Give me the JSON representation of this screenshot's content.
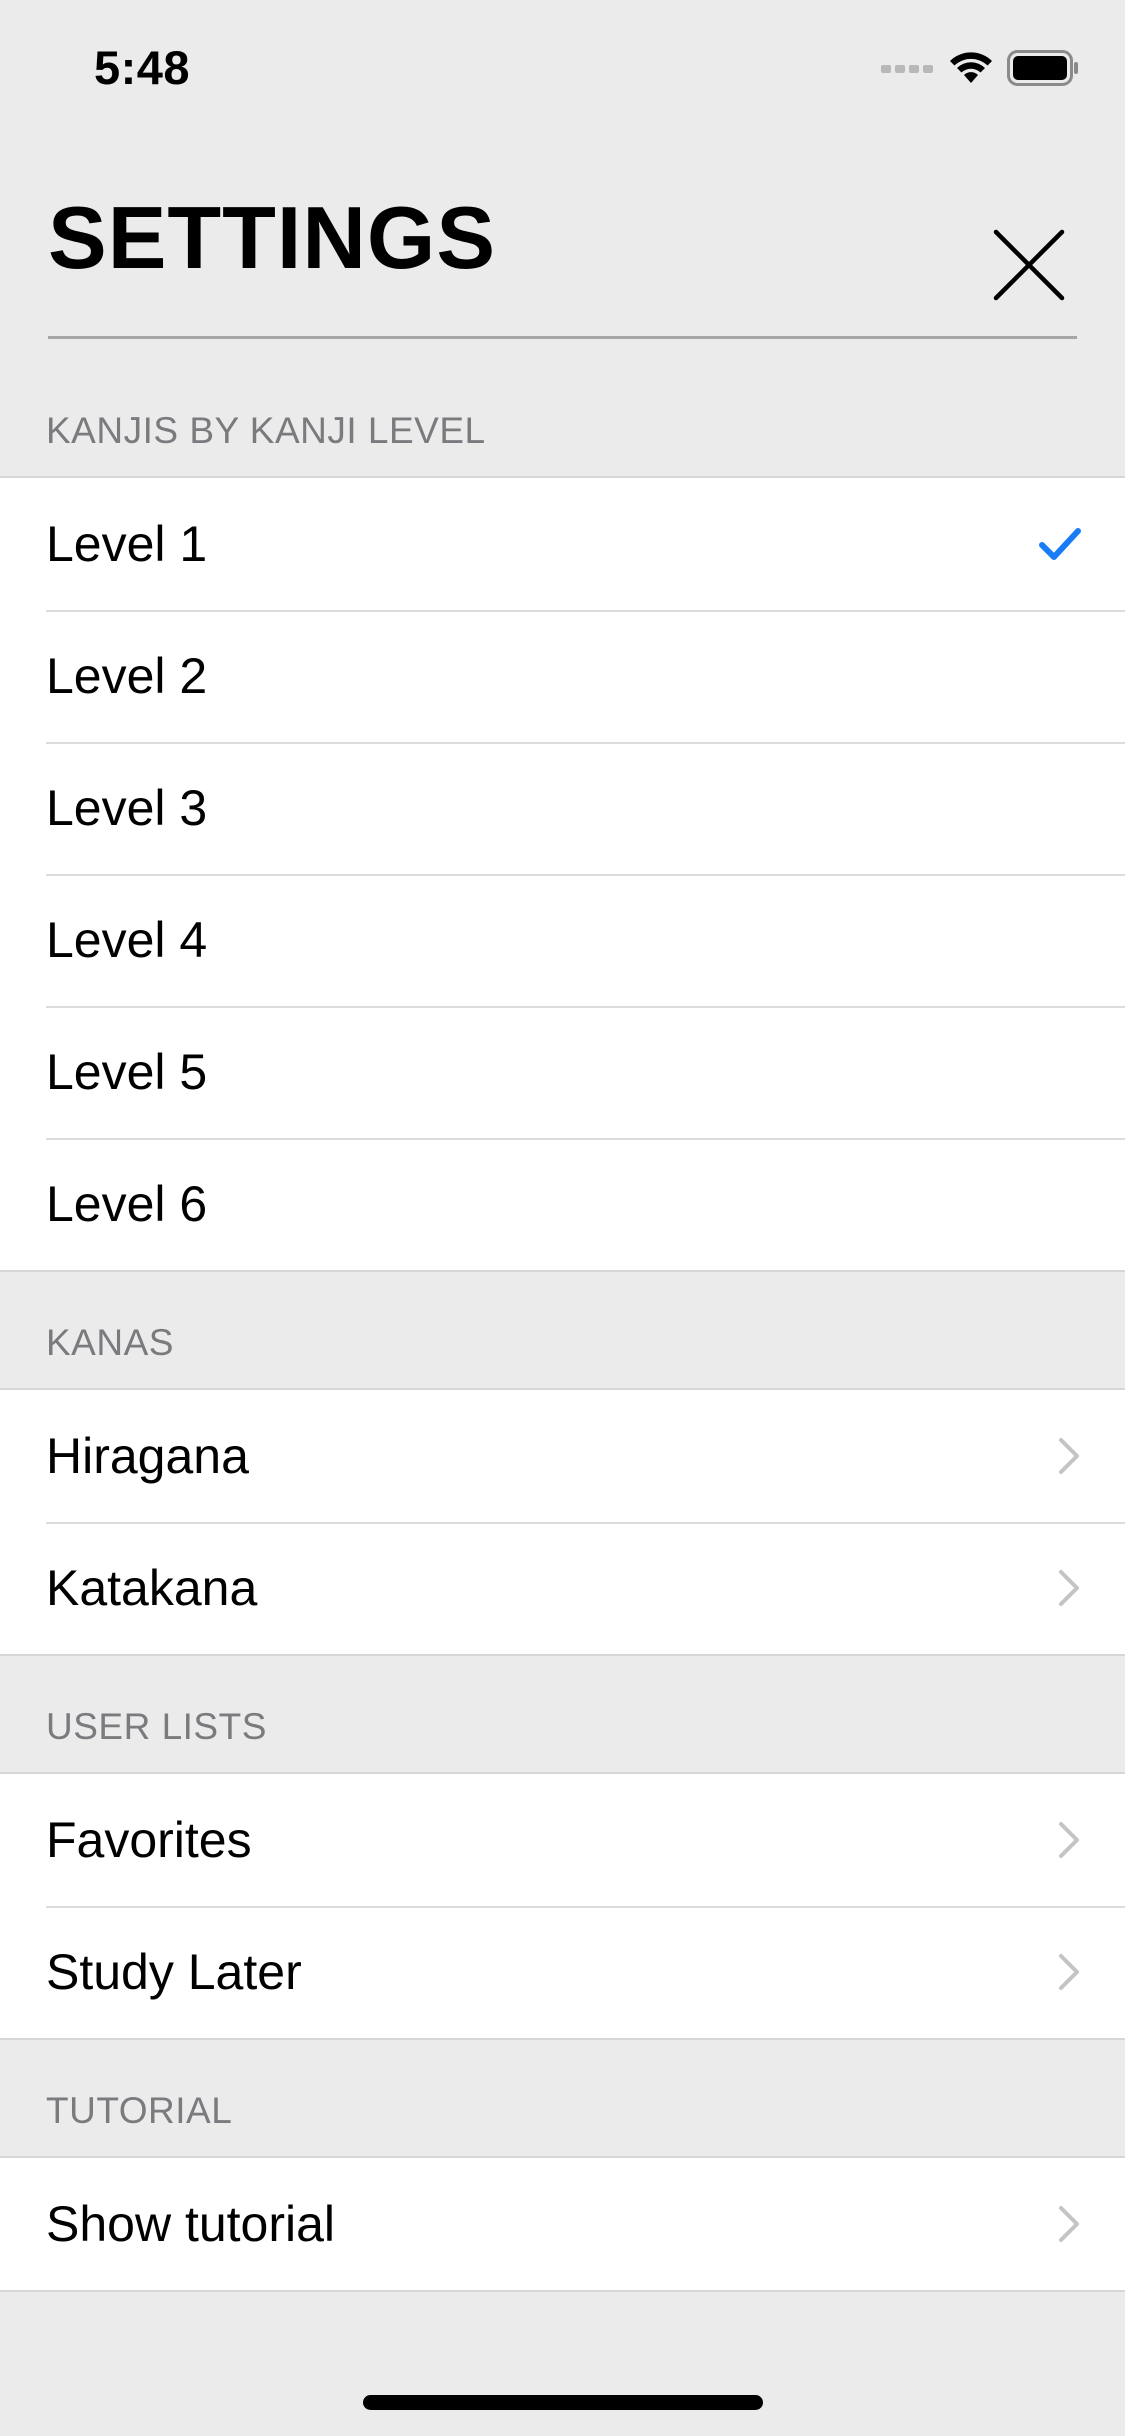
{
  "status_bar": {
    "time": "5:48",
    "icons": [
      "cellular-signal-icon",
      "wifi-icon",
      "battery-icon"
    ]
  },
  "header": {
    "title": "SETTINGS",
    "close_icon": "close-icon"
  },
  "sections": {
    "kanji_levels": {
      "title": "KANJIS BY KANJI LEVEL",
      "items": [
        {
          "label": "Level 1",
          "selected": true
        },
        {
          "label": "Level 2",
          "selected": false
        },
        {
          "label": "Level 3",
          "selected": false
        },
        {
          "label": "Level 4",
          "selected": false
        },
        {
          "label": "Level 5",
          "selected": false
        },
        {
          "label": "Level 6",
          "selected": false
        }
      ]
    },
    "kanas": {
      "title": "KANAS",
      "items": [
        {
          "label": "Hiragana"
        },
        {
          "label": "Katakana"
        }
      ]
    },
    "user_lists": {
      "title": "USER LISTS",
      "items": [
        {
          "label": "Favorites"
        },
        {
          "label": "Study Later"
        }
      ]
    },
    "tutorial": {
      "title": "TUTORIAL",
      "items": [
        {
          "label": "Show tutorial"
        }
      ]
    }
  },
  "colors": {
    "accent": "#1a7cf5",
    "background": "#ebebeb",
    "section_header": "#7a7a7f",
    "chevron": "#c4c4c6"
  }
}
